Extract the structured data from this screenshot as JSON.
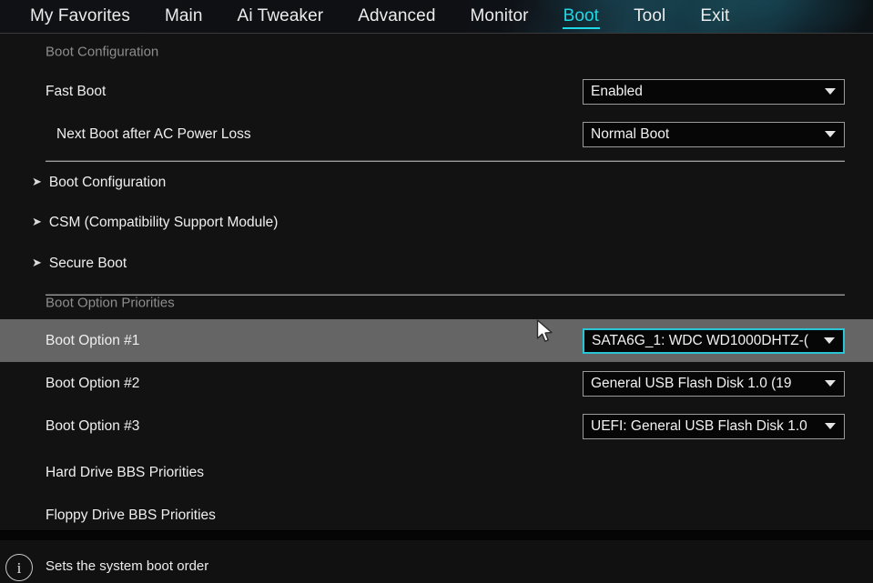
{
  "nav": {
    "tabs": [
      {
        "label": "My Favorites",
        "active": false
      },
      {
        "label": "Main",
        "active": false
      },
      {
        "label": "Ai Tweaker",
        "active": false
      },
      {
        "label": "Advanced",
        "active": false
      },
      {
        "label": "Monitor",
        "active": false
      },
      {
        "label": "Boot",
        "active": true
      },
      {
        "label": "Tool",
        "active": false
      },
      {
        "label": "Exit",
        "active": false
      }
    ]
  },
  "main": {
    "section_boot_config": "Boot Configuration",
    "fast_boot": {
      "label": "Fast Boot",
      "value": "Enabled"
    },
    "next_boot_ac_loss": {
      "label": "Next Boot after AC Power Loss",
      "value": "Normal Boot"
    },
    "submenus": [
      {
        "label": "Boot Configuration",
        "arrow": "right-arrow-icon"
      },
      {
        "label": "CSM (Compatibility Support Module)",
        "arrow": "right-arrow-icon"
      },
      {
        "label": "Secure Boot",
        "arrow": "right-arrow-icon"
      }
    ],
    "section_boot_priorities": "Boot Option Priorities",
    "boot_options": [
      {
        "label": "Boot Option #1",
        "value": "SATA6G_1: WDC WD1000DHTZ-(",
        "selected": true
      },
      {
        "label": "Boot Option #2",
        "value": "General USB Flash Disk 1.0  (19",
        "selected": false
      },
      {
        "label": "Boot Option #3",
        "value": "UEFI: General USB Flash Disk 1.0",
        "selected": false
      }
    ],
    "bbs_menus": [
      {
        "label": "Hard Drive BBS Priorities"
      },
      {
        "label": "Floppy Drive BBS Priorities"
      }
    ]
  },
  "footer": {
    "icon": "info-icon",
    "icon_glyph": "i",
    "help_text": "Sets the system boot order"
  },
  "colors": {
    "accent": "#1fd9e8",
    "selected_border": "#29c4d6",
    "highlight_row": "#656565",
    "background": "#121212",
    "section_text": "#8d8d8d"
  },
  "icons": {
    "arrow_glyph": "➤",
    "caret": "chevron-down-icon"
  }
}
